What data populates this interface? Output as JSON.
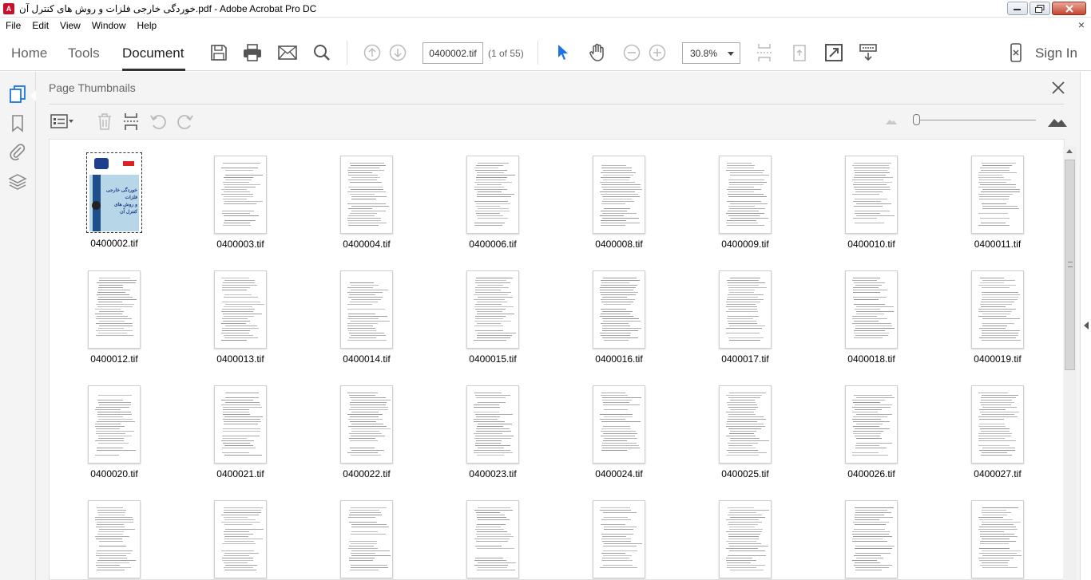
{
  "window": {
    "title": "خوردگی خارجی فلزات و روش های کنترل آن.pdf - Adobe Acrobat Pro DC",
    "app_icon_text": "A"
  },
  "menu": {
    "items": [
      "File",
      "Edit",
      "View",
      "Window",
      "Help"
    ],
    "close_glyph": "×"
  },
  "toolbar": {
    "tabs": {
      "home": "Home",
      "tools": "Tools",
      "document": "Document"
    },
    "page_field": "0400002.tif",
    "page_count": "(1 of 55)",
    "zoom_value": "30.8%",
    "sign_in": "Sign In",
    "icons": [
      "save-icon",
      "print-icon",
      "email-icon",
      "search-icon",
      "prev-page-icon",
      "next-page-icon",
      "select-cursor-icon",
      "hand-tool-icon",
      "zoom-out-icon",
      "zoom-in-icon",
      "fit-page-icon",
      "rotate-view-icon",
      "full-screen-icon",
      "read-mode-icon",
      "mobile-icon"
    ]
  },
  "panel": {
    "title": "Page Thumbnails",
    "close_glyph": "×"
  },
  "cover": {
    "title_line1": "خوردگی خارجی فلزات",
    "title_line2": "و روش های کنترل آن"
  },
  "thumbnails": [
    "0400002.tif",
    "0400003.tif",
    "0400004.tif",
    "0400006.tif",
    "0400008.tif",
    "0400009.tif",
    "0400010.tif",
    "0400011.tif",
    "0400012.tif",
    "0400013.tif",
    "0400014.tif",
    "0400015.tif",
    "0400016.tif",
    "0400017.tif",
    "0400018.tif",
    "0400019.tif",
    "0400020.tif",
    "0400021.tif",
    "0400022.tif",
    "0400023.tif",
    "0400024.tif",
    "0400025.tif",
    "0400026.tif",
    "0400027.tif",
    "",
    "",
    "",
    "",
    "",
    "",
    "",
    ""
  ],
  "selected_thumbnail": "0400002.tif",
  "colors": {
    "accent_blue": "#1a73e8",
    "title_text": "#666666"
  }
}
